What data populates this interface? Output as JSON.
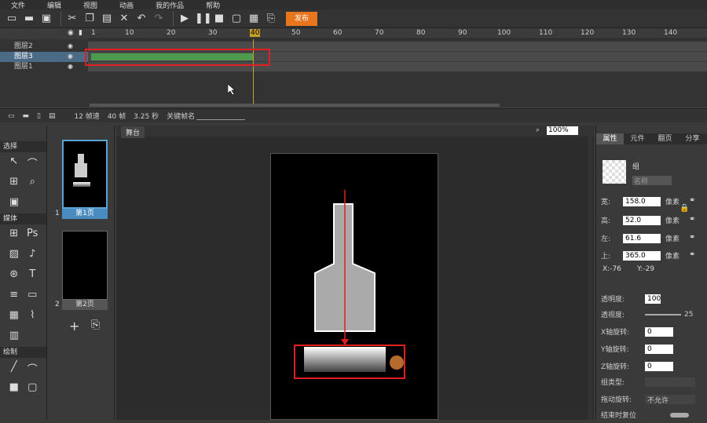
{
  "menu": [
    "文件",
    "编辑",
    "视图",
    "动画",
    "我的作品",
    "帮助"
  ],
  "toolbar": {
    "publish": "发布"
  },
  "timeline": {
    "ticks": [
      "1",
      "10",
      "20",
      "30",
      "40",
      "50",
      "60",
      "70",
      "80",
      "90",
      "100",
      "110",
      "120",
      "130",
      "140"
    ],
    "layers": [
      "图层2",
      "图层3",
      "图层1"
    ],
    "fps": "12 帧速",
    "frames": "40 帧",
    "time": "3.25 秒",
    "keyframe_label": "关键帧名"
  },
  "tools": {
    "select": "选择",
    "media": "媒体",
    "draw": "绘制",
    "ps": "Ps"
  },
  "pages": [
    {
      "num": "1",
      "label": "第1页"
    },
    {
      "num": "2",
      "label": "第2页"
    }
  ],
  "stage": {
    "tab": "舞台",
    "zoom": "100%"
  },
  "props": {
    "tabs": [
      "属性",
      "元件",
      "翻页",
      "分享"
    ],
    "group": "组",
    "name_placeholder": "名称",
    "width_label": "宽:",
    "width": "158.0",
    "height_label": "高:",
    "height": "52.0",
    "left_label": "左:",
    "left": "61.6",
    "top_label": "上:",
    "top": "365.0",
    "unit": "像素",
    "x": "X:-76",
    "y": "Y:-29",
    "opacity_label": "透明度:",
    "opacity": "100",
    "perspective_label": "透视度:",
    "perspective": "25",
    "xrot_label": "X轴旋转:",
    "yrot_label": "Y轴旋转:",
    "zrot_label": "Z轴旋转:",
    "rot_value": "0",
    "group_type_label": "组类型:",
    "drag_label": "拖动旋转:",
    "drag_value": "不允许",
    "reset_label": "结束时复位"
  }
}
